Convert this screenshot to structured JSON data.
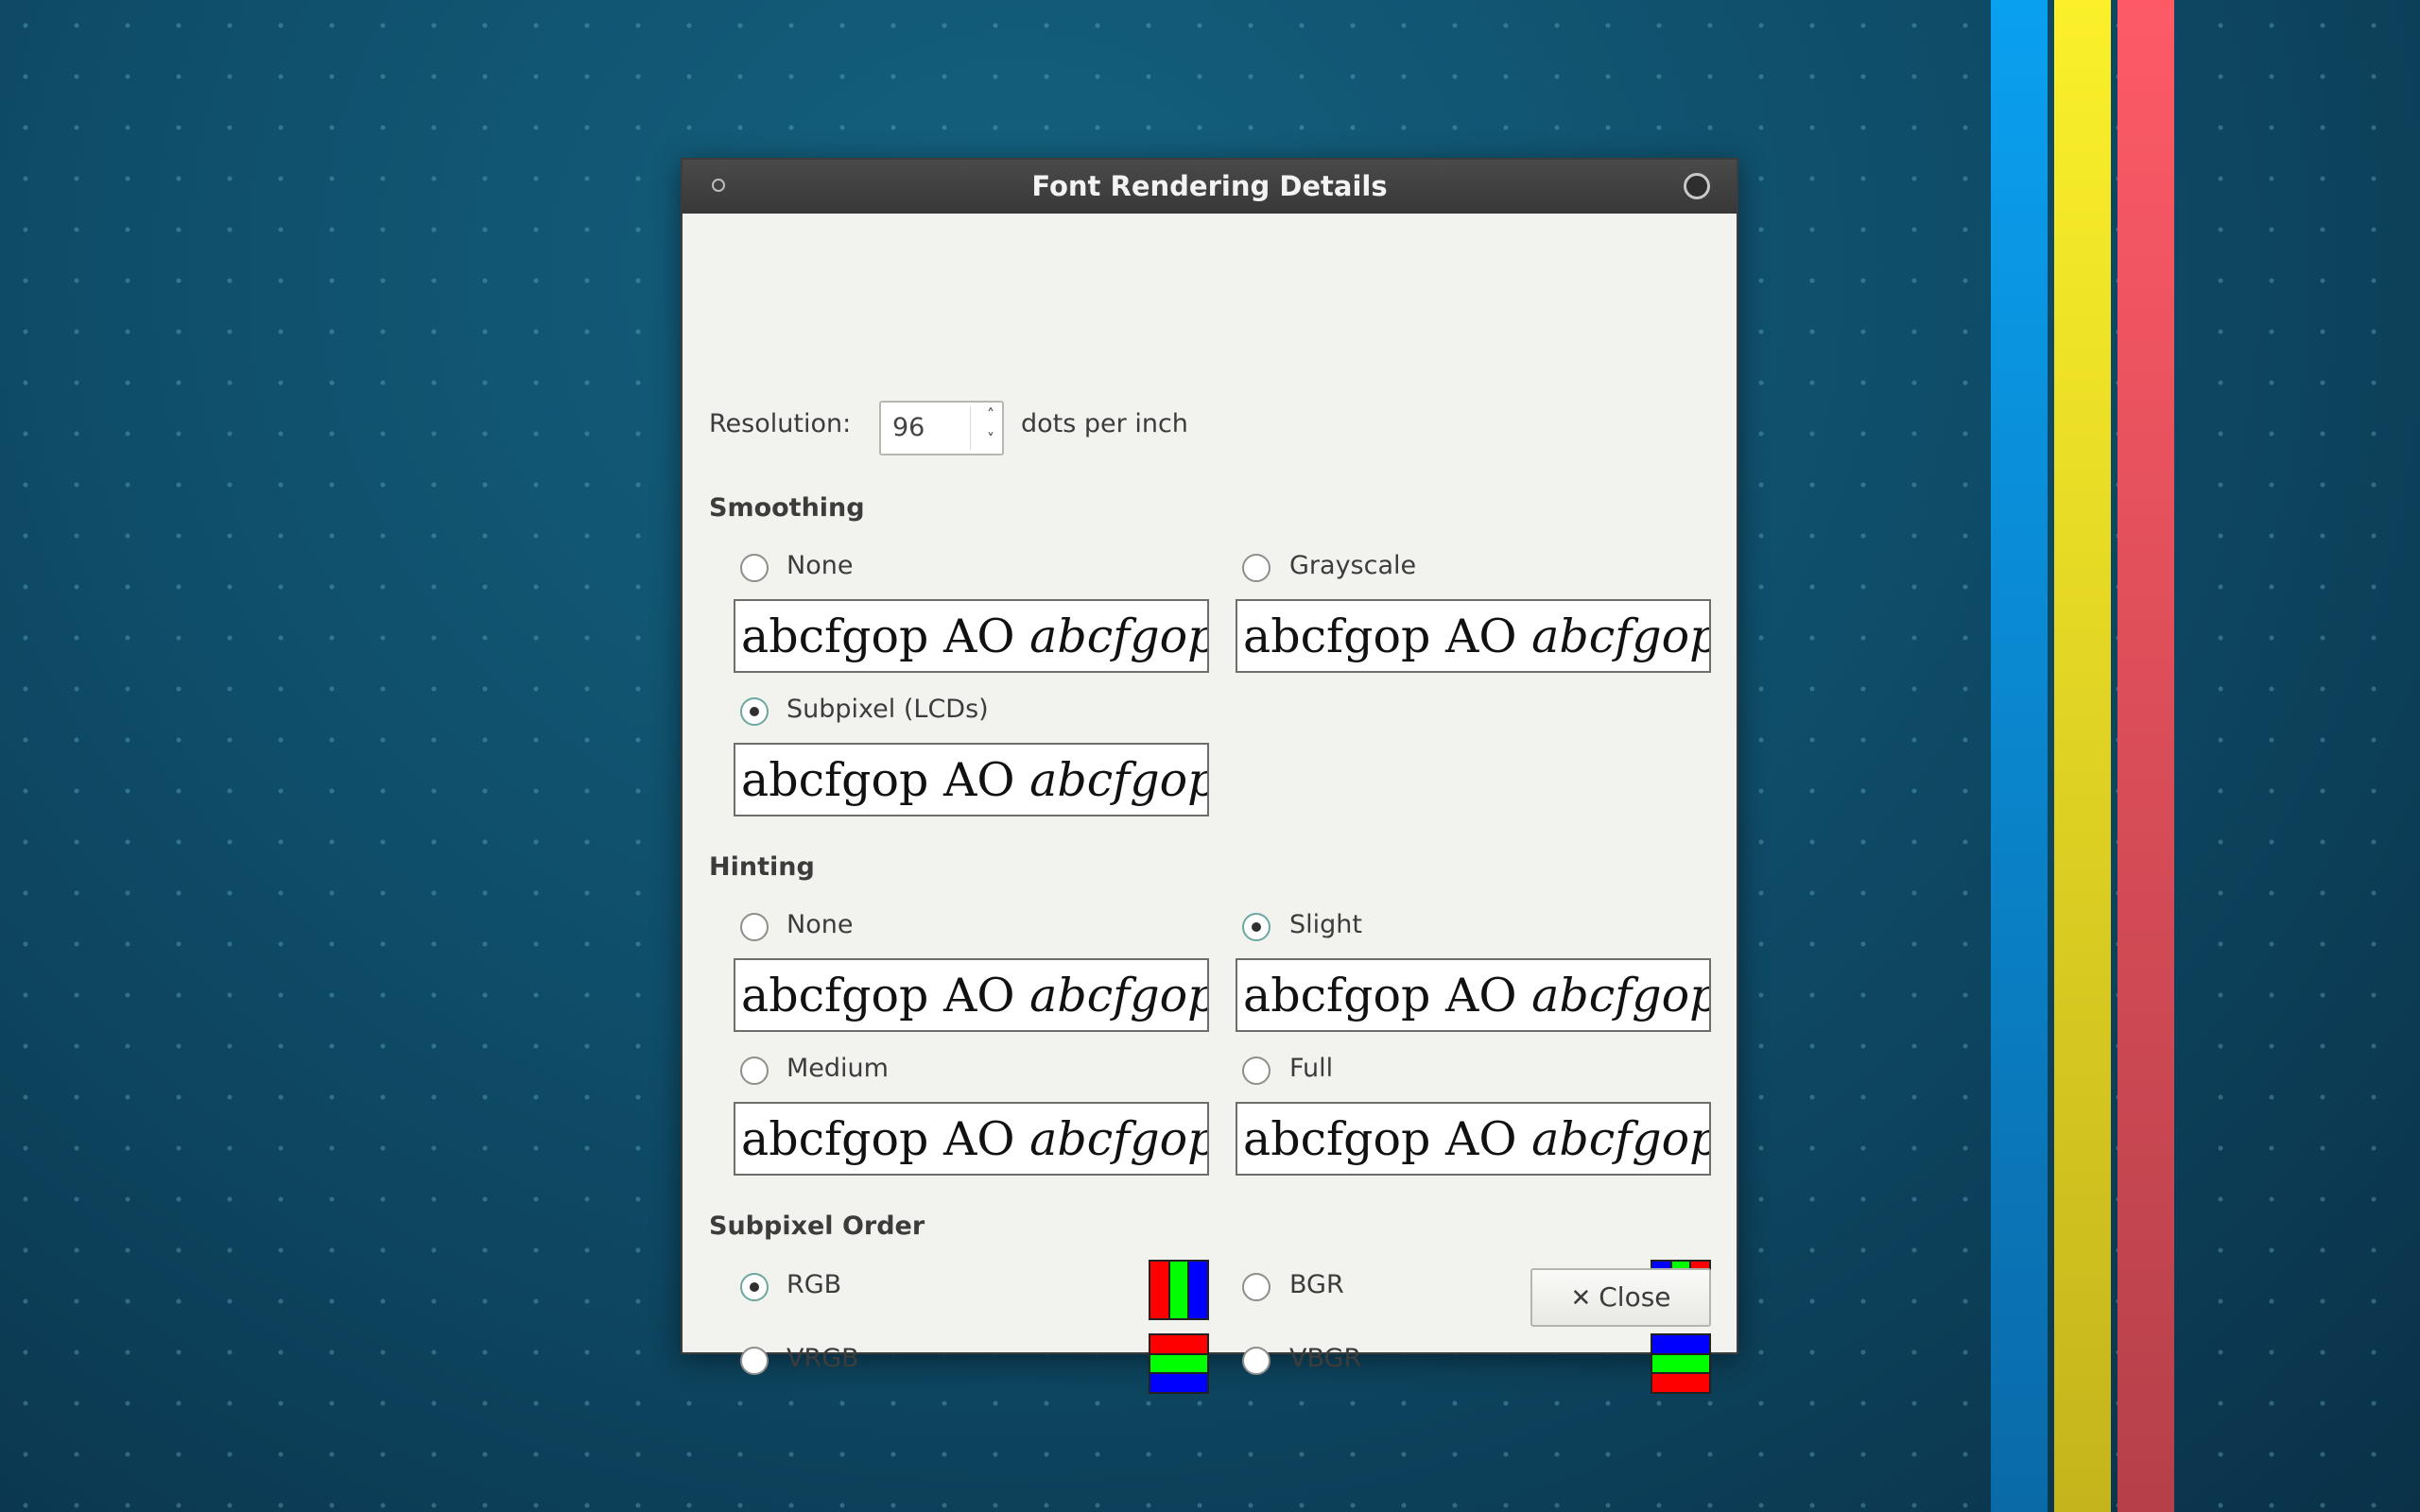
{
  "window": {
    "title": "Font Rendering Details"
  },
  "resolution": {
    "label": "Resolution:",
    "value": "96",
    "unit": "dots per inch"
  },
  "sample_text": {
    "regular": "abcfgop AO ",
    "italic": "abcfgop"
  },
  "smoothing": {
    "title": "Smoothing",
    "options": [
      {
        "label": "None",
        "checked": false
      },
      {
        "label": "Grayscale",
        "checked": false
      },
      {
        "label": "Subpixel (LCDs)",
        "checked": true
      }
    ]
  },
  "hinting": {
    "title": "Hinting",
    "options": [
      {
        "label": "None",
        "checked": false
      },
      {
        "label": "Slight",
        "checked": true
      },
      {
        "label": "Medium",
        "checked": false
      },
      {
        "label": "Full",
        "checked": false
      }
    ]
  },
  "subpixel_order": {
    "title": "Subpixel Order",
    "options": [
      {
        "label": "RGB",
        "checked": true,
        "colors": [
          "#ff0000",
          "#00ff00",
          "#0000ff"
        ]
      },
      {
        "label": "BGR",
        "checked": false,
        "colors": [
          "#0000ff",
          "#00ff00",
          "#ff0000"
        ]
      },
      {
        "label": "VRGB",
        "checked": false,
        "colors": [
          "#ff0000",
          "#00ff00",
          "#0000ff"
        ]
      },
      {
        "label": "VBGR",
        "checked": false,
        "colors": [
          "#0000ff",
          "#00ff00",
          "#ff0000"
        ]
      }
    ]
  },
  "buttons": {
    "close_label": "Close"
  },
  "icons": {
    "close": "close-icon"
  }
}
